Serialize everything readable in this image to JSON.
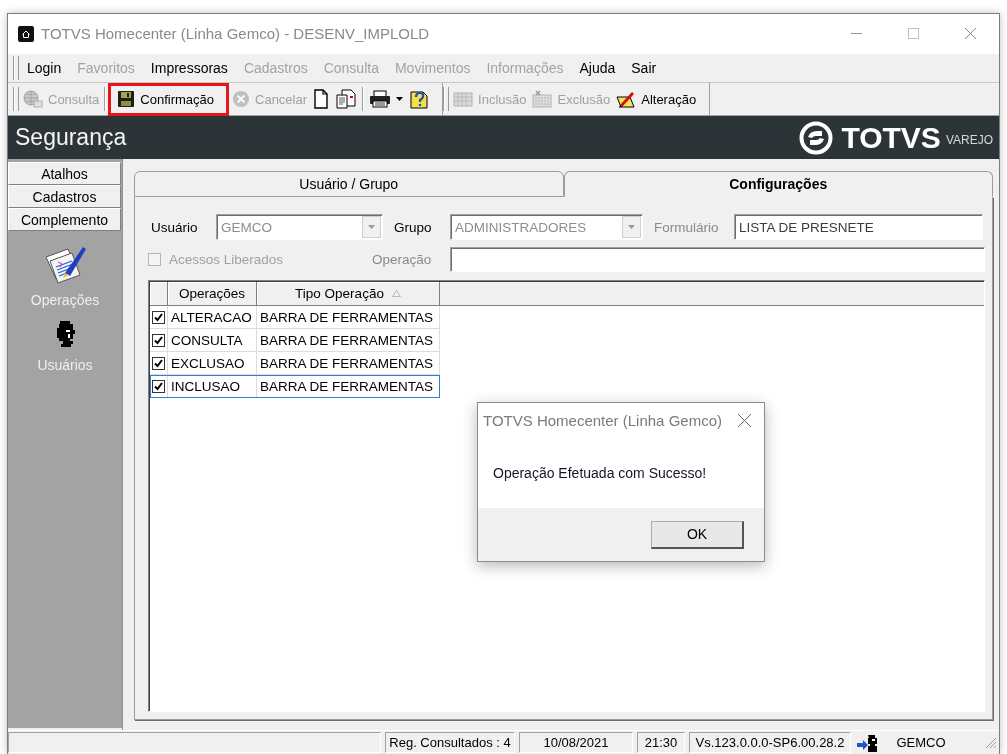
{
  "window": {
    "title": "TOTVS Homecenter (Linha Gemco) - DESENV_IMPLOLD"
  },
  "menu": [
    {
      "label": "Login",
      "disabled": false
    },
    {
      "label": "Favoritos",
      "disabled": true
    },
    {
      "label": "Impressoras",
      "disabled": false
    },
    {
      "label": "Cadastros",
      "disabled": true
    },
    {
      "label": "Consulta",
      "disabled": true
    },
    {
      "label": "Movimentos",
      "disabled": true
    },
    {
      "label": "Informações",
      "disabled": true
    },
    {
      "label": "Ajuda",
      "disabled": false
    },
    {
      "label": "Sair",
      "disabled": false
    }
  ],
  "toolbar": {
    "bands": [
      {
        "groups": [
          {
            "items": [
              {
                "kind": "labeled",
                "label": "Consulta",
                "disabled": true,
                "highlighted": false
              }
            ]
          },
          {
            "items": [
              {
                "kind": "labeled",
                "label": "Confirmação",
                "disabled": false,
                "highlighted": true
              },
              {
                "kind": "labeled",
                "label": "Cancelar",
                "disabled": true,
                "highlighted": false
              },
              {
                "kind": "icon",
                "disabled": false,
                "highlighted": false
              },
              {
                "kind": "icon",
                "disabled": false,
                "highlighted": false
              }
            ]
          },
          {
            "items": [
              {
                "kind": "dropdown",
                "disabled": false,
                "highlighted": false
              },
              {
                "kind": "icon",
                "disabled": false,
                "highlighted": false
              }
            ]
          }
        ]
      },
      {
        "groups": [
          {
            "items": [
              {
                "kind": "labeled",
                "label": "Inclusão",
                "disabled": true,
                "highlighted": false
              },
              {
                "kind": "labeled",
                "label": "Exclusão",
                "disabled": true,
                "highlighted": false
              },
              {
                "kind": "labeled",
                "label": "Alteração",
                "disabled": false,
                "highlighted": false
              }
            ]
          }
        ]
      }
    ]
  },
  "header": {
    "title": "Segurança",
    "logo": {
      "name": "TOTVS",
      "tagline": "VAREJO"
    }
  },
  "sidebar": {
    "sections": [
      {
        "label": "Atalhos"
      },
      {
        "label": "Cadastros"
      },
      {
        "label": "Complemento",
        "items": [
          {
            "label": "Operações"
          },
          {
            "label": "Usuários"
          }
        ]
      }
    ]
  },
  "tabs": [
    {
      "label": "Usuário / Grupo",
      "selected": false
    },
    {
      "label": "Configurações",
      "selected": true
    }
  ],
  "form": {
    "rows": [
      {
        "fields": [
          {
            "kind": "combo",
            "label": "Usuário",
            "label_disabled": false,
            "value": "GEMCO",
            "disabled": true
          },
          {
            "kind": "combo",
            "label": "Grupo",
            "label_disabled": false,
            "value": "ADMINISTRADORES",
            "disabled": true
          },
          {
            "kind": "text",
            "label": "Formulário",
            "label_disabled": true,
            "value": "LISTA DE PRESNETE",
            "disabled": false
          }
        ]
      },
      {
        "fields": [
          {
            "kind": "checkbox",
            "label": "Acessos Liberados",
            "checked": false,
            "disabled": true
          },
          {
            "kind": "text",
            "label": "Operação",
            "label_disabled": true,
            "disabled": false
          }
        ]
      }
    ]
  },
  "grid": {
    "columns": [
      {
        "label": "Operações",
        "sorted": false
      },
      {
        "label": "Tipo Operação",
        "sorted": true
      }
    ],
    "rows": [
      {
        "checked": true,
        "selected": false,
        "cells": [
          "ALTERACAO",
          "BARRA DE FERRAMENTAS"
        ]
      },
      {
        "checked": true,
        "selected": false,
        "cells": [
          "CONSULTA",
          "BARRA DE FERRAMENTAS"
        ]
      },
      {
        "checked": true,
        "selected": false,
        "cells": [
          "EXCLUSAO",
          "BARRA DE FERRAMENTAS"
        ]
      },
      {
        "checked": true,
        "selected": true,
        "cells": [
          "INCLUSAO",
          "BARRA DE FERRAMENTAS"
        ]
      }
    ]
  },
  "dialog": {
    "title": "TOTVS Homecenter (Linha Gemco)",
    "message": "Operação Efetuada com Sucesso!",
    "buttons": [
      "OK"
    ]
  },
  "status_bar": {
    "panels": [
      {
        "kind": "empty"
      },
      {
        "kind": "text",
        "text": "Reg. Consultados : 4"
      },
      {
        "kind": "text",
        "text": "10/08/2021"
      },
      {
        "kind": "text",
        "text": "21:30"
      },
      {
        "kind": "text",
        "text": "Vs.123.0.0.0-SP6.00.28.2"
      },
      {
        "kind": "icon"
      },
      {
        "kind": "plain",
        "text": "GEMCO"
      }
    ]
  }
}
